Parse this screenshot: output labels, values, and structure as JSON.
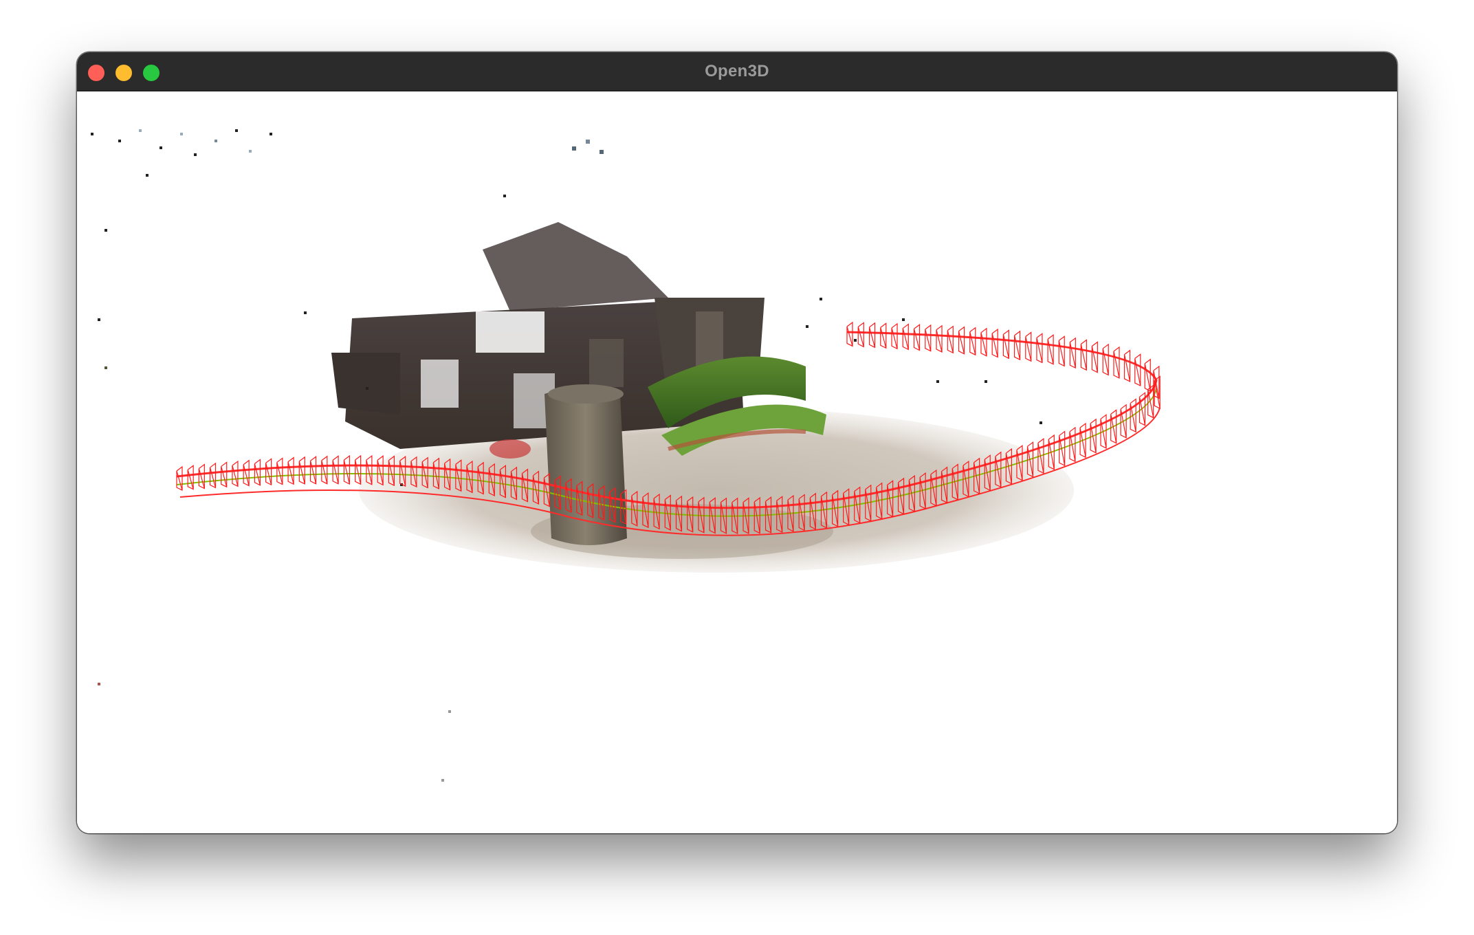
{
  "window": {
    "title": "Open3D",
    "controls": {
      "close_color": "#ff5f57",
      "minimize_color": "#febc2e",
      "maximize_color": "#28c840"
    }
  },
  "viewport": {
    "background": "#ffffff",
    "scene": {
      "content": "point-cloud-reconstruction",
      "camera_frustum_color": "#ff0000",
      "trajectory_color": "#7fbf00"
    }
  }
}
